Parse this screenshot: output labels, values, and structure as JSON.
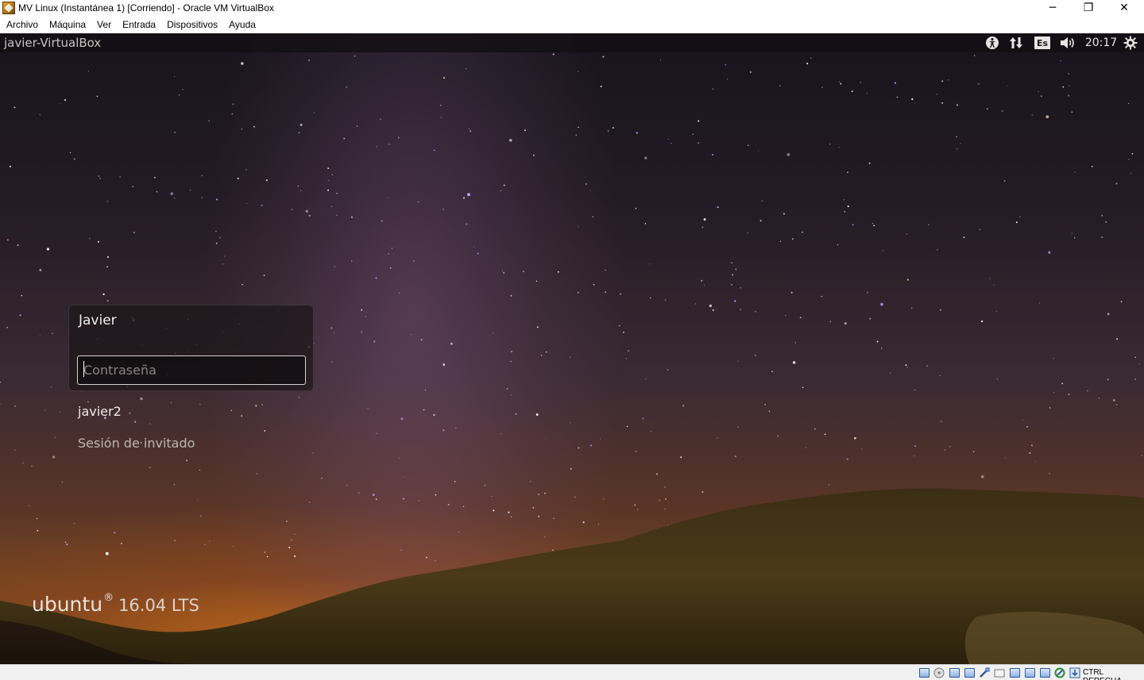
{
  "window": {
    "title": "MV Linux (Instantánea 1) [Corriendo] - Oracle VM VirtualBox",
    "controls": {
      "minimize": "─",
      "restore": "❐",
      "close": "✕"
    }
  },
  "menubar": {
    "items": [
      "Archivo",
      "Máquina",
      "Ver",
      "Entrada",
      "Dispositivos",
      "Ayuda"
    ]
  },
  "guest": {
    "panel": {
      "hostname": "javier-VirtualBox",
      "indicators": {
        "accessibility_icon": "accessibility-icon",
        "network_icon": "network-icon",
        "keyboard_layout": "Es",
        "sound_icon": "sound-icon",
        "clock": "20:17",
        "power_icon": "power-icon"
      }
    },
    "login": {
      "selected_user": "Javier",
      "password_placeholder": "Contraseña",
      "password_value": "",
      "other_users": [
        "javier2",
        "Sesión de invitado"
      ]
    },
    "branding": {
      "distro": "ubuntu",
      "registered": "®",
      "version": "16.04 LTS"
    }
  },
  "statusbar": {
    "icons": [
      "hard-disk-icon",
      "optical-drive-icon",
      "audio-icon",
      "network-adapters-icon",
      "usb-icon",
      "shared-folders-icon",
      "display-icon",
      "video-capture-icon",
      "recording-icon",
      "virtualization-icon",
      "guest-additions-icon",
      "mouse-integration-icon",
      "keyboard-capture-icon"
    ],
    "host_key": "CTRL DERECHA"
  },
  "colors": {
    "panel_bg": "#121014",
    "login_bg": "#1c1618",
    "ubuntu_text": "#e8e3df",
    "horizon_glow": "#d67418"
  }
}
